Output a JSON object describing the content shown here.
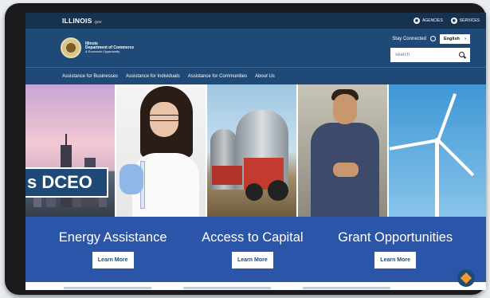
{
  "topbar": {
    "brand": "ILLINOIS",
    "brand_suffix": ".gov",
    "links": [
      {
        "label": "AGENCIES",
        "icon": "agencies-icon"
      },
      {
        "label": "SERVICES",
        "icon": "services-icon"
      }
    ]
  },
  "header": {
    "dept_line1": "Illinois",
    "dept_line2": "Department of Commerce",
    "dept_line3": "& Economic Opportunity",
    "stay_connected": "Stay Connected",
    "language": "English",
    "search_placeholder": "search"
  },
  "nav": {
    "items": [
      "Assistance for Businesses",
      "Assistance for Individuals",
      "Assistance for Communities",
      "About Us"
    ]
  },
  "hero": {
    "badge_text": "s DCEO"
  },
  "ctas": [
    {
      "title": "Energy Assistance",
      "button": "Learn More"
    },
    {
      "title": "Access to Capital",
      "button": "Learn More"
    },
    {
      "title": "Grant Opportunities",
      "button": "Learn More"
    }
  ],
  "colors": {
    "navy": "#17324f",
    "header_blue": "#1f4a78",
    "band_blue": "#2a55a8",
    "accent_orange": "#f29a2e"
  }
}
